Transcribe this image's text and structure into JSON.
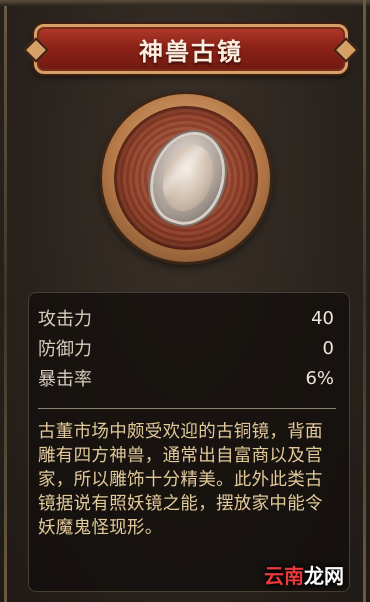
{
  "item": {
    "title": "神兽古镜",
    "icon": "bronze-mirror-icon"
  },
  "stats": [
    {
      "label": "攻击力",
      "value": "40"
    },
    {
      "label": "防御力",
      "value": "0"
    },
    {
      "label": "暴击率",
      "value": "6%"
    }
  ],
  "description": "古董市场中颇受欢迎的古铜镜，背面雕有四方神兽，通常出自富商以及官家，所以雕饰十分精美。此外此类古镜据说有照妖镜之能，摆放家中能令妖魔鬼怪现形。",
  "watermark": {
    "prefix": "云南",
    "suffix": "龙网"
  },
  "colors": {
    "banner_red": "#8d2217",
    "banner_border": "#d7a067",
    "description_text": "#e2c99a",
    "stat_text": "#d9cfc2",
    "watermark_accent": "#e83a3a"
  }
}
